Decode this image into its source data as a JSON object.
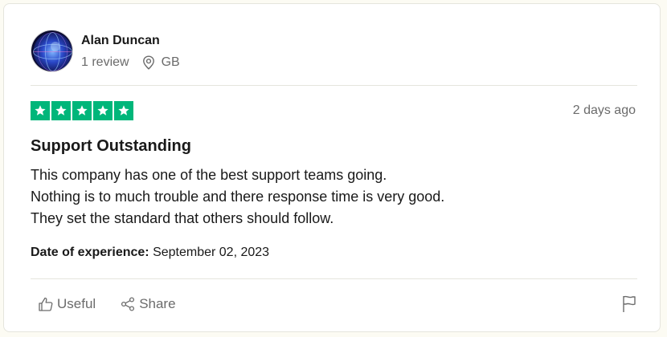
{
  "consumer": {
    "name": "Alan Duncan",
    "review_count": "1 review",
    "country": "GB"
  },
  "review": {
    "rating": 5,
    "rating_color": "#00b67a",
    "posted": "2 days ago",
    "title": "Support Outstanding",
    "body_lines": [
      "This company has one of the best support teams going.",
      "Nothing is to much trouble and there response time is very good.",
      "They set the standard that others should follow."
    ],
    "experience_label": "Date of experience:",
    "experience_date": "September 02, 2023"
  },
  "actions": {
    "useful_label": "Useful",
    "share_label": "Share"
  },
  "icons": {
    "avatar": "globe-avatar",
    "location": "location-pin-icon",
    "useful": "thumbs-up-icon",
    "share": "share-icon",
    "flag": "flag-icon",
    "star": "star-icon"
  }
}
